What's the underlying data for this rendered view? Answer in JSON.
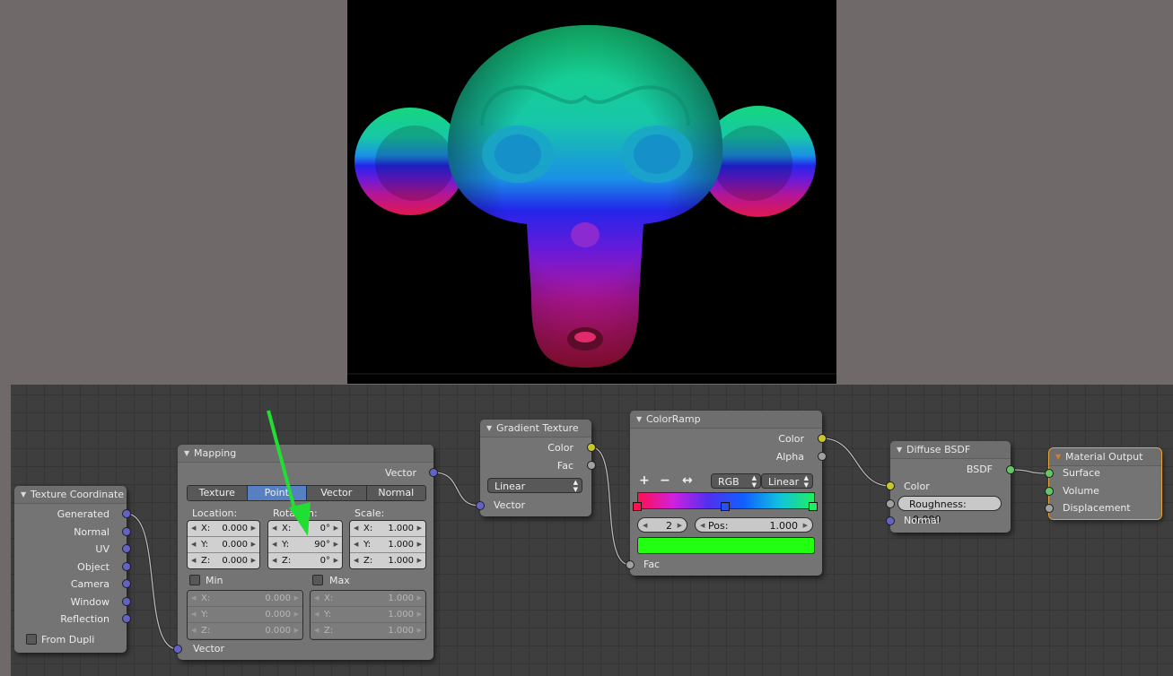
{
  "preview": {
    "colors": [
      "#17e08a",
      "#1b8ee8",
      "#2a2ae6",
      "#8a18d6",
      "#e0185a"
    ]
  },
  "annotation": {
    "arrow_color": "#22dd33"
  },
  "nodes": {
    "texture_coordinate": {
      "title": "Texture Coordinate",
      "outputs": [
        "Generated",
        "Normal",
        "UV",
        "Object",
        "Camera",
        "Window",
        "Reflection"
      ],
      "from_dupli": "From Dupli"
    },
    "mapping": {
      "title": "Mapping",
      "output": "Vector",
      "modes": [
        "Texture",
        "Point",
        "Vector",
        "Normal"
      ],
      "active_mode": "Point",
      "location_label": "Location:",
      "rotation_label": "Rotation:",
      "scale_label": "Scale:",
      "location": [
        {
          "axis": "X:",
          "value": "0.000"
        },
        {
          "axis": "Y:",
          "value": "0.000"
        },
        {
          "axis": "Z:",
          "value": "0.000"
        }
      ],
      "rotation": [
        {
          "axis": "X:",
          "value": "0°"
        },
        {
          "axis": "Y:",
          "value": "90°"
        },
        {
          "axis": "Z:",
          "value": "0°"
        }
      ],
      "scale": [
        {
          "axis": "X:",
          "value": "1.000"
        },
        {
          "axis": "Y:",
          "value": "1.000"
        },
        {
          "axis": "Z:",
          "value": "1.000"
        }
      ],
      "min_label": "Min",
      "max_label": "Max",
      "min": [
        {
          "axis": "X:",
          "value": "0.000"
        },
        {
          "axis": "Y:",
          "value": "0.000"
        },
        {
          "axis": "Z:",
          "value": "0.000"
        }
      ],
      "max": [
        {
          "axis": "X:",
          "value": "1.000"
        },
        {
          "axis": "Y:",
          "value": "1.000"
        },
        {
          "axis": "Z:",
          "value": "1.000"
        }
      ],
      "input": "Vector"
    },
    "gradient_texture": {
      "title": "Gradient Texture",
      "outputs": [
        "Color",
        "Fac"
      ],
      "type": "Linear",
      "input": "Vector"
    },
    "color_ramp": {
      "title": "ColorRamp",
      "outputs": [
        "Color",
        "Alpha"
      ],
      "add": "+",
      "remove": "−",
      "flip": "↔",
      "color_mode": "RGB",
      "interpolation": "Linear",
      "active_stop": "2",
      "pos_label": "Pos:",
      "pos_value": "1.000",
      "stop_color": "#22ff11",
      "ramp_colors": [
        "#ff1050",
        "#d020e0",
        "#5030f0",
        "#1060ff",
        "#10c0e0",
        "#20f060"
      ],
      "input": "Fac"
    },
    "diffuse_bsdf": {
      "title": "Diffuse BSDF",
      "output": "BSDF",
      "inputs": [
        "Color",
        "Normal"
      ],
      "roughness_label": "Roughness:",
      "roughness_value": "0.000"
    },
    "material_output": {
      "title": "Material Output",
      "inputs": [
        "Surface",
        "Volume",
        "Displacement"
      ]
    }
  }
}
